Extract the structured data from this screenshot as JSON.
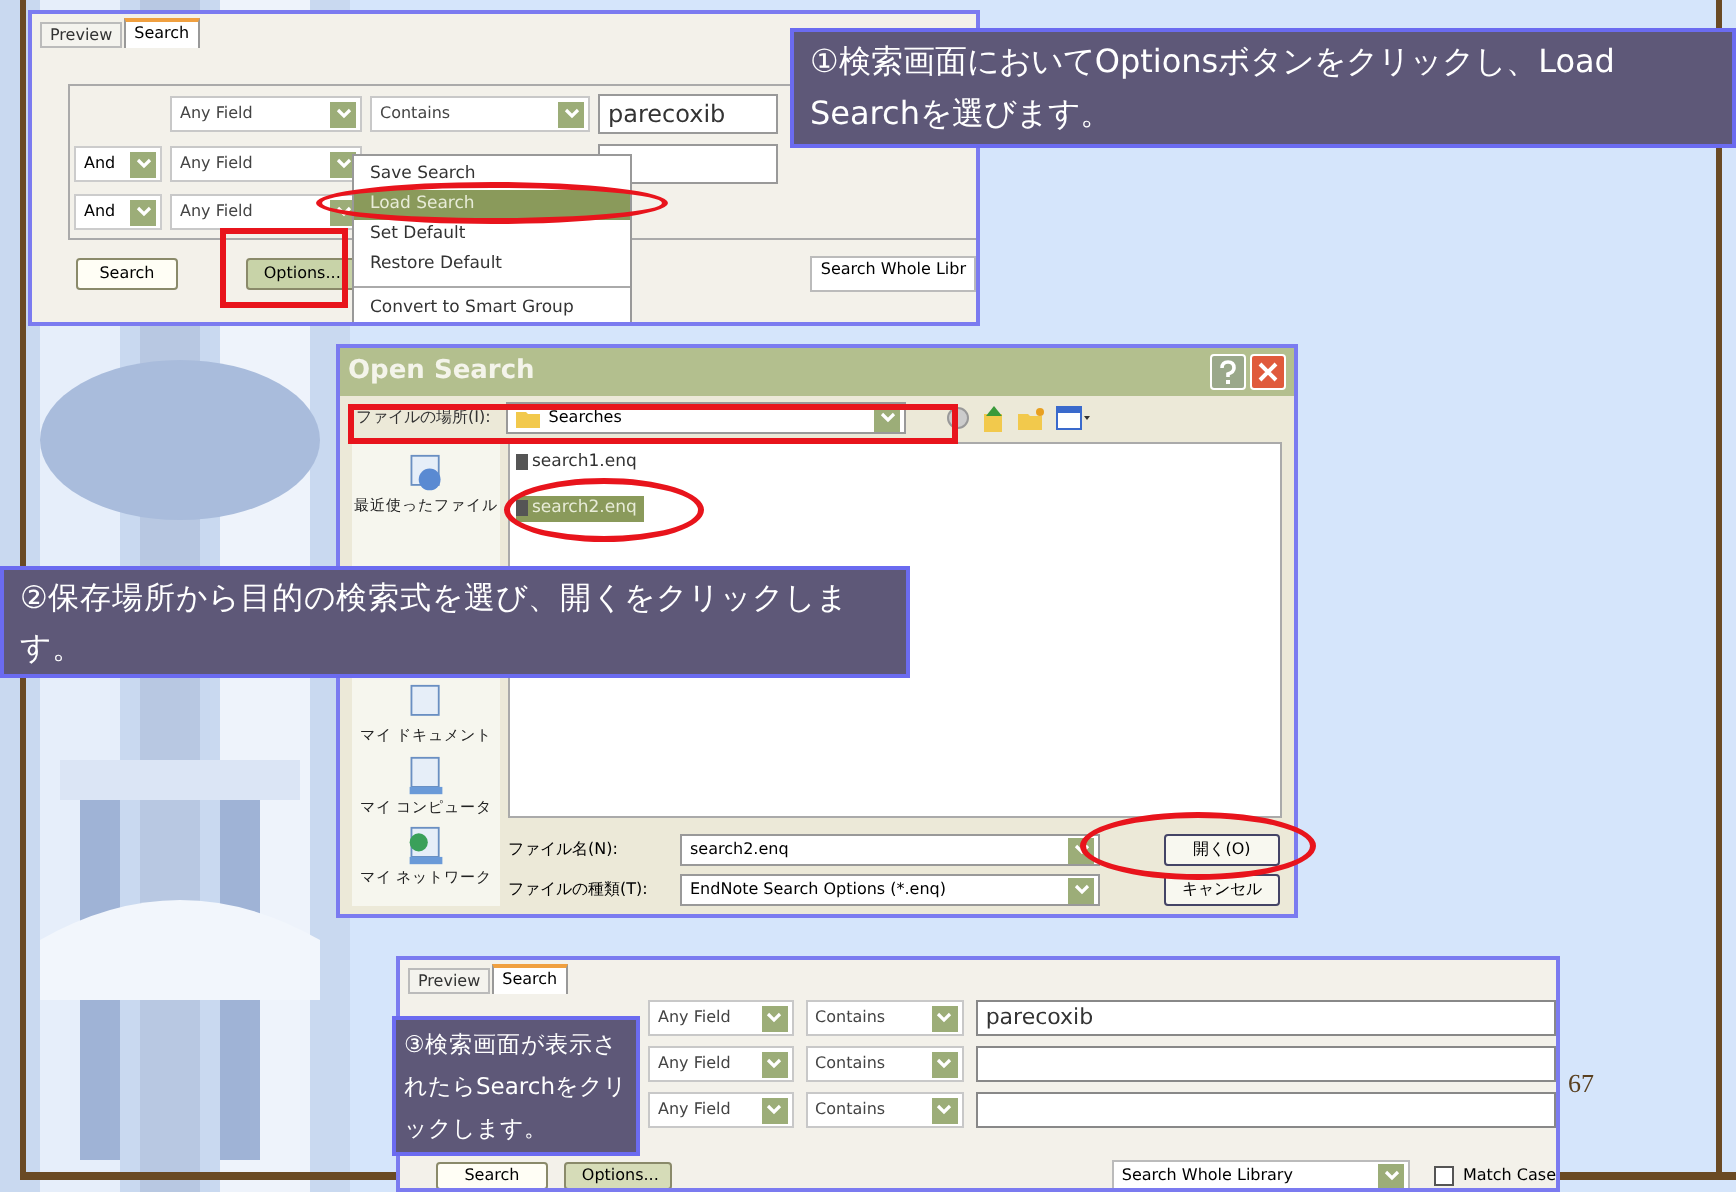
{
  "search_panel_top": {
    "tabs": [
      {
        "label": "Preview",
        "selected": false
      },
      {
        "label": "Search",
        "selected": true
      }
    ],
    "rows": [
      {
        "field": "Any Field",
        "operator": "Contains",
        "value": "parecoxib"
      },
      {
        "connector": "And",
        "field": "Any Field",
        "value": ""
      },
      {
        "connector": "And",
        "field": "Any Field"
      }
    ],
    "buttons": [
      "Search",
      "Options..."
    ],
    "scope": "Search Whole Libr",
    "menu": [
      [
        {
          "label": "Save Search",
          "selected": false
        },
        {
          "label": "Load Search",
          "selected": true
        },
        {
          "label": "Set Default",
          "selected": false
        },
        {
          "label": "Restore Default",
          "selected": false
        }
      ],
      [
        {
          "label": "Convert to Smart Group",
          "selected": false
        }
      ]
    ]
  },
  "callouts": [
    "①検索画面においてOptionsボタンをクリックし、Load Searchを選びます。",
    "②保存場所から目的の検索式を選び、開くをクリックします。",
    "③検索画面が表示されたらSearchをクリックします。"
  ],
  "open_dialog": {
    "title": "Open Search",
    "location_label": "ファイルの場所(I):",
    "location": "Searches",
    "places": [
      "最近使ったファイル",
      "マイ ドキュメント",
      "マイ コンピュータ",
      "マイ ネットワーク"
    ],
    "files": [
      {
        "name": "search1.enq",
        "selected": false
      },
      {
        "name": "search2.enq",
        "selected": true
      }
    ],
    "filename_label": "ファイル名(N):",
    "filename": "search2.enq",
    "filetype_label": "ファイルの種類(T):",
    "filetype": "EndNote Search Options (*.enq)",
    "buttons": [
      "開く(O)",
      "キャンセル"
    ]
  },
  "search_panel_bottom": {
    "tabs": [
      {
        "label": "Preview",
        "selected": false
      },
      {
        "label": "Search",
        "selected": true
      }
    ],
    "rows": [
      {
        "field": "Any Field",
        "operator": "Contains",
        "value": "parecoxib"
      },
      {
        "field": "Any Field",
        "operator": "Contains",
        "value": ""
      },
      {
        "field": "Any Field",
        "operator": "Contains",
        "value": ""
      }
    ],
    "buttons": [
      "Search",
      "Options..."
    ],
    "scope": "Search Whole Library",
    "match_case": {
      "label": "Match Case",
      "checked": false
    }
  },
  "page_number": "67"
}
